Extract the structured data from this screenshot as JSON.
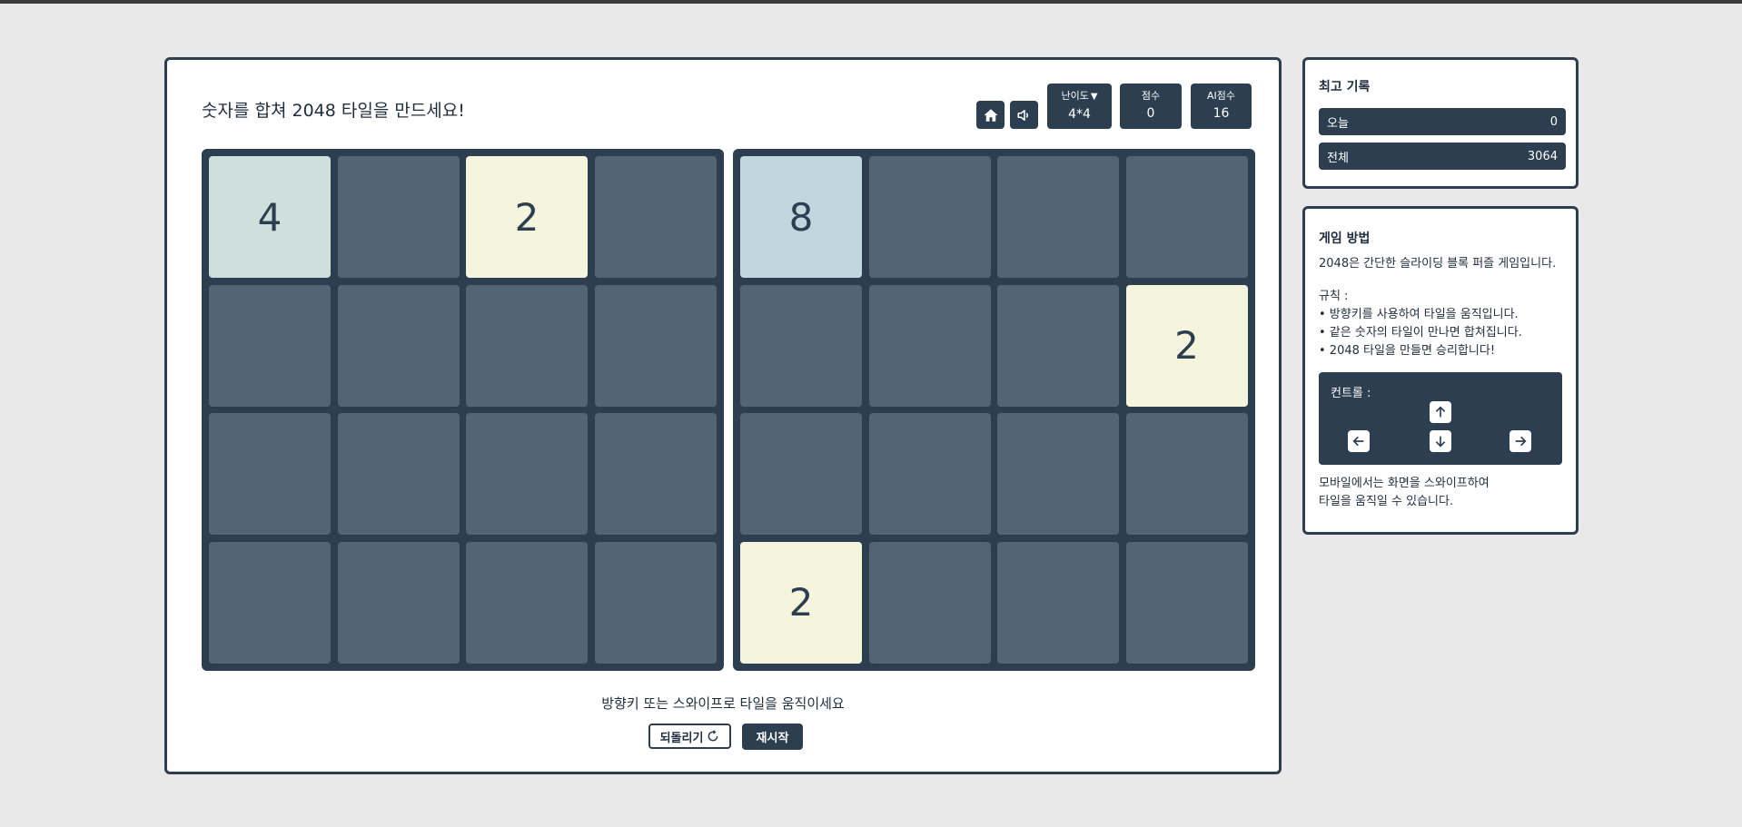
{
  "header": {
    "instruction": "숫자를 합쳐 2048 타일을 만드세요!",
    "icons": {
      "home": "home-icon",
      "sound": "sound-icon"
    },
    "difficulty": {
      "label": "난이도",
      "caret": "▼",
      "value": "4*4"
    },
    "score": {
      "label": "점수",
      "value": "0"
    },
    "ai_score": {
      "label": "AI점수",
      "value": "16"
    }
  },
  "boards": {
    "player": [
      [
        "4",
        "",
        "2",
        ""
      ],
      [
        "",
        "",
        "",
        ""
      ],
      [
        "",
        "",
        "",
        ""
      ],
      [
        "",
        "",
        "",
        ""
      ]
    ],
    "ai": [
      [
        "8",
        "",
        "",
        ""
      ],
      [
        "",
        "",
        "",
        "2"
      ],
      [
        "",
        "",
        "",
        ""
      ],
      [
        "2",
        "",
        "",
        ""
      ]
    ]
  },
  "footer": {
    "hint": "방향키 또는 스와이프로 타일을 움직이세요",
    "undo_label": "되돌리기",
    "restart_label": "재시작"
  },
  "records": {
    "title": "최고 기록",
    "today_label": "오늘",
    "today_value": "0",
    "total_label": "전체",
    "total_value": "3064"
  },
  "howto": {
    "title": "게임 방법",
    "intro": "2048은 간단한 슬라이딩 블록 퍼즐 게임입니다.",
    "rules_title": "규칙 :",
    "rules": [
      "• 방향키를 사용하여 타일을 움직입니다.",
      "• 같은 숫자의 타일이 만나면 합쳐집니다.",
      "• 2048 타일을 만들면 승리합니다!"
    ],
    "controls_label": "컨트롤 :",
    "mobile_line1": "모바일에서는 화면을 스와이프하여",
    "mobile_line2": "타일을 움직일 수 있습니다."
  },
  "colors": {
    "primary": "#2c3e50",
    "empty_cell": "#546474",
    "tile_2": "#f4f5dc",
    "tile_4": "#cfe0dc",
    "tile_8": "#c0d7e0"
  }
}
